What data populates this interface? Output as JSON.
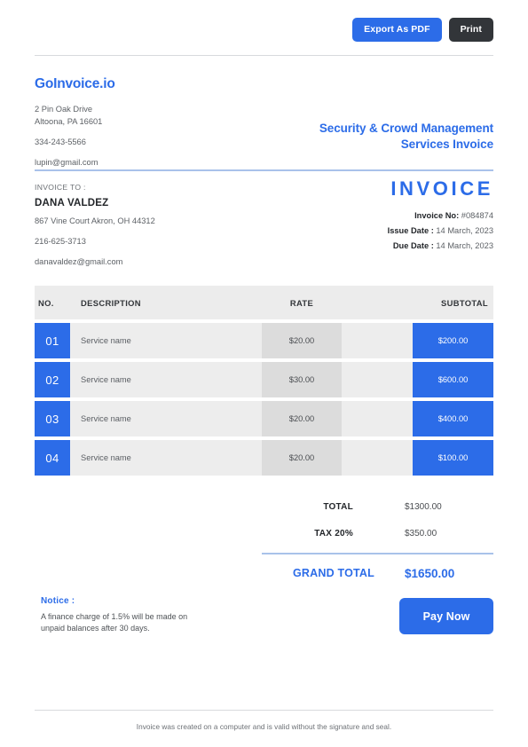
{
  "toolbar": {
    "export_label": "Export As PDF",
    "print_label": "Print"
  },
  "seller": {
    "brand": "GoInvoice.io",
    "address_line1": "2 Pin Oak Drive",
    "address_line2": "Altoona, PA 16601",
    "phone": "334-243-5566",
    "email": "lupin@gmail.com"
  },
  "service_title": {
    "line1": "Security & Crowd Management",
    "line2": "Services Invoice"
  },
  "bill_to": {
    "label": "INVOICE TO :",
    "name": "DANA VALDEZ",
    "address": "867 Vine Court  Akron, OH 44312",
    "phone": "216-625-3713",
    "email": "danavaldez@gmail.com"
  },
  "meta": {
    "title": "INVOICE",
    "invoice_no_label": "Invoice No:",
    "invoice_no_value": "#084874",
    "issue_date_label": "Issue Date :",
    "issue_date_value": "14 March, 2023",
    "due_date_label": "Due Date :",
    "due_date_value": "14 March, 2023"
  },
  "table": {
    "headers": {
      "no": "NO.",
      "description": "DESCRIPTION",
      "rate": "RATE",
      "qty": "",
      "subtotal": "SUBTOTAL"
    },
    "rows": [
      {
        "no": "01",
        "description": "Service name",
        "rate": "$20.00",
        "qty": "",
        "subtotal": "$200.00"
      },
      {
        "no": "02",
        "description": "Service name",
        "rate": "$30.00",
        "qty": "",
        "subtotal": "$600.00"
      },
      {
        "no": "03",
        "description": "Service name",
        "rate": "$20.00",
        "qty": "",
        "subtotal": "$400.00"
      },
      {
        "no": "04",
        "description": "Service name",
        "rate": "$20.00",
        "qty": "",
        "subtotal": "$100.00"
      }
    ]
  },
  "totals": {
    "total_label": "TOTAL",
    "total_value": "$1300.00",
    "tax_label": "TAX 20%",
    "tax_value": "$350.00",
    "grand_total_label": "GRAND TOTAL",
    "grand_total_value": "$1650.00"
  },
  "notice": {
    "title": "Notice :",
    "line1": "A finance charge of 1.5% will be made on",
    "line2": "unpaid balances after 30 days."
  },
  "pay_button": {
    "label": "Pay Now"
  },
  "footer": {
    "text": "Invoice was created on a computer and is valid without the signature and seal."
  },
  "colors": {
    "accent_blue": "#2c6ce8",
    "dark_button": "#323539",
    "row_light_gray": "#ededed",
    "row_rate_gray": "#dcdcdc",
    "header_gray": "#ececec",
    "rule_gray": "#d8dadd",
    "rule_blue": "#a9c2ea"
  }
}
